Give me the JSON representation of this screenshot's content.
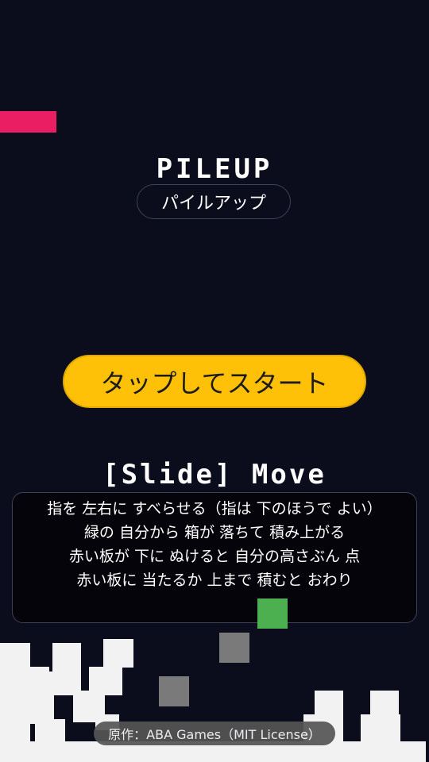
{
  "title": {
    "main": "PILEUP",
    "subtitle": "パイルアップ"
  },
  "start_button": {
    "label": "タップしてスタート"
  },
  "controls": {
    "hint": "[Slide] Move"
  },
  "instructions": {
    "lines": [
      "指を 左右に すべらせる（指は 下のほうで よい）",
      "緑の 自分から 箱が 落ちて 積み上がる",
      "赤い板が 下に ぬけると 自分の高さぶん 点",
      "赤い板に 当たるか 上まで 積むと おわり"
    ]
  },
  "credit": {
    "text": "原作：ABA Games（MIT License）"
  },
  "colors": {
    "background": "#0b0d1c",
    "player": "#4caf50",
    "hazard": "#e91e63",
    "start_button": "#ffc107",
    "pile": "#f2f2f2",
    "falling_box": "#7a7a7a"
  }
}
